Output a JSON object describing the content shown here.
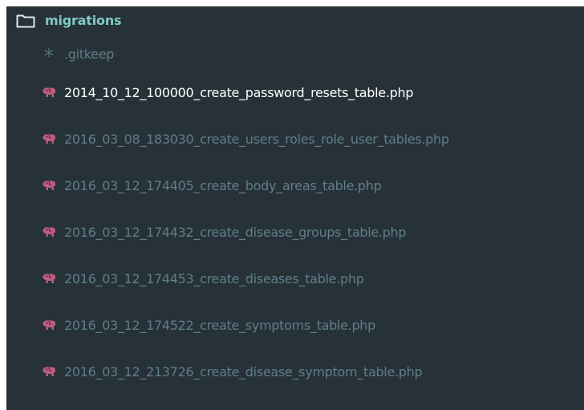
{
  "folder": {
    "label": "migrations",
    "icon": "folder-icon"
  },
  "files": [
    {
      "label": ".gitkeep",
      "icon": "asterisk-icon",
      "active": false
    },
    {
      "label": "2014_10_12_100000_create_password_resets_table.php",
      "icon": "php-elephant-icon",
      "active": true
    },
    {
      "label": "2016_03_08_183030_create_users_roles_role_user_tables.php",
      "icon": "php-elephant-icon",
      "active": false
    },
    {
      "label": "2016_03_12_174405_create_body_areas_table.php",
      "icon": "php-elephant-icon",
      "active": false
    },
    {
      "label": "2016_03_12_174432_create_disease_groups_table.php",
      "icon": "php-elephant-icon",
      "active": false
    },
    {
      "label": "2016_03_12_174453_create_diseases_table.php",
      "icon": "php-elephant-icon",
      "active": false
    },
    {
      "label": "2016_03_12_174522_create_symptoms_table.php",
      "icon": "php-elephant-icon",
      "active": false
    },
    {
      "label": "2016_03_12_213726_create_disease_symptom_table.php",
      "icon": "php-elephant-icon",
      "active": false
    }
  ],
  "colors": {
    "background": "#263238",
    "folder_text": "#80cbc4",
    "file_text": "#607d8b",
    "active_text": "#ffffff",
    "php_icon": "#c05a7e",
    "asterisk": "#546e7a"
  }
}
